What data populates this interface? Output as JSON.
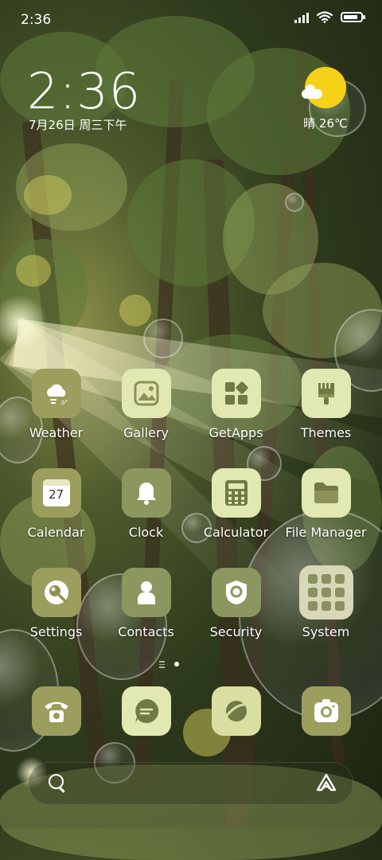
{
  "status_bar": {
    "time": "2:36",
    "signal_icon": "signal-bars-icon",
    "wifi_icon": "wifi-icon",
    "battery_icon": "battery-icon",
    "battery_level": 0.85
  },
  "clock_widget": {
    "time": "2:36",
    "date": "7月26日 周三下午"
  },
  "weather_widget": {
    "icon": "sunny-cloud-icon",
    "text": "晴 26℃"
  },
  "apps": [
    {
      "label": "Weather",
      "icon": "weather-cloud-icon"
    },
    {
      "label": "Gallery",
      "icon": "gallery-image-icon"
    },
    {
      "label": "GetApps",
      "icon": "getapps-grid-icon"
    },
    {
      "label": "Themes",
      "icon": "themes-brush-icon"
    },
    {
      "label": "Calendar",
      "icon": "calendar-icon",
      "badge": "27"
    },
    {
      "label": "Clock",
      "icon": "bell-icon"
    },
    {
      "label": "Calculator",
      "icon": "calculator-icon"
    },
    {
      "label": "File Manager",
      "icon": "folder-icon"
    },
    {
      "label": "Settings",
      "icon": "settings-icon"
    },
    {
      "label": "Contacts",
      "icon": "contact-person-icon"
    },
    {
      "label": "Security",
      "icon": "security-shield-icon"
    },
    {
      "label": "System",
      "icon": "system-folder-icon"
    }
  ],
  "page_indicator": {
    "current_page": 1,
    "total_dots": 1
  },
  "dock": [
    {
      "name": "phone",
      "icon": "phone-icon"
    },
    {
      "name": "messages",
      "icon": "message-bubble-icon"
    },
    {
      "name": "browser",
      "icon": "browser-planet-icon"
    },
    {
      "name": "camera",
      "icon": "camera-icon"
    }
  ],
  "search_bar": {
    "search_icon": "search-icon",
    "assistant_icon": "assistant-icon"
  },
  "colors": {
    "tile_olive": "#9b9e5d",
    "tile_light": "#e2e8b2",
    "sun": "#f5d218"
  }
}
